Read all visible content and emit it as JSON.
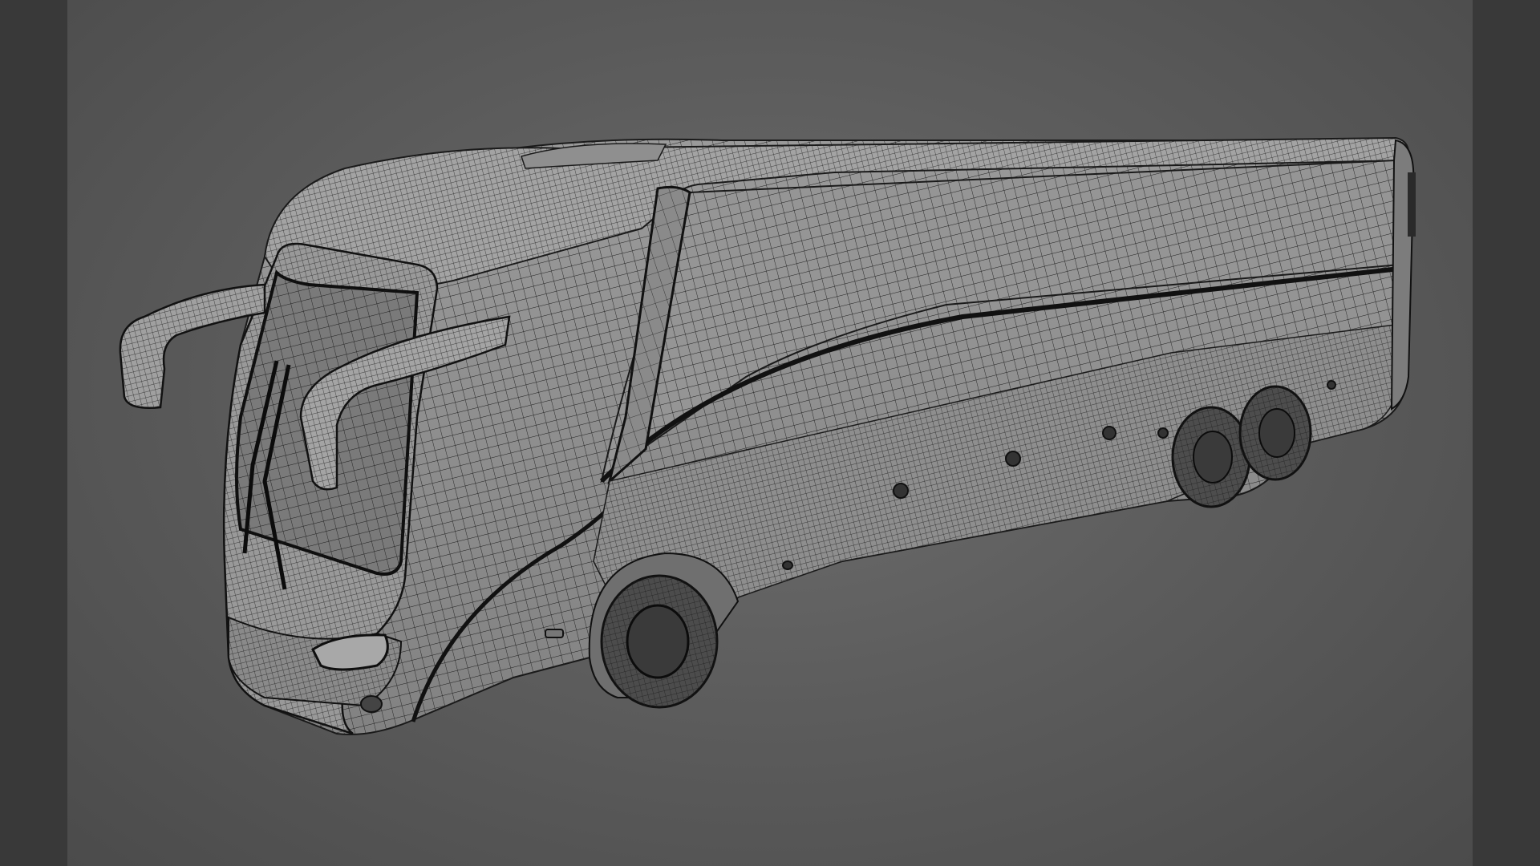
{
  "scene": {
    "subject": "coach-bus-wireframe",
    "render_mode": "wireframe-on-shaded",
    "colors": {
      "background": "#5f5f5f",
      "side_bars": "#393939",
      "surface": "#8d8d8d",
      "surface_light": "#a0a0a0",
      "wire": "#1c1c1c",
      "glass": "#747474"
    }
  }
}
